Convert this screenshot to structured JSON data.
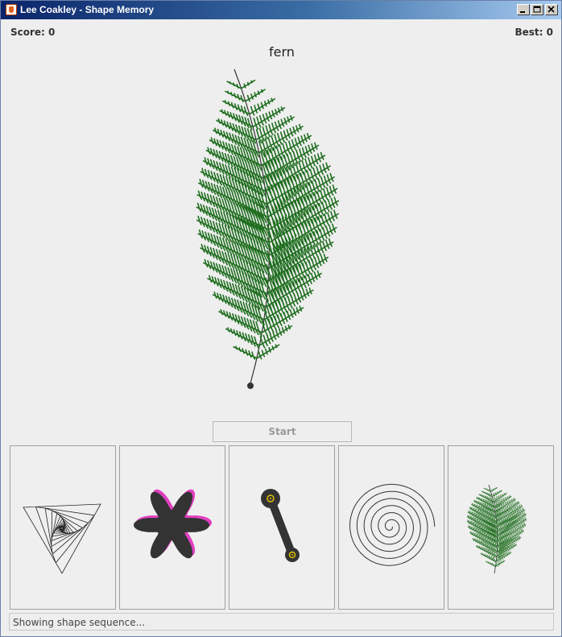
{
  "window": {
    "title": "Lee Coakley - Shape Memory"
  },
  "header": {
    "score_label": "Score: 0",
    "best_label": "Best: 0"
  },
  "display": {
    "shape_name": "fern",
    "shape_icon": "fern-icon"
  },
  "controls": {
    "start_label": "Start"
  },
  "sequence": [
    {
      "name": "triangle-spiral-icon"
    },
    {
      "name": "blob-star-icon"
    },
    {
      "name": "lever-icon"
    },
    {
      "name": "spiral-icon"
    },
    {
      "name": "fern-icon"
    }
  ],
  "status": {
    "text": "Showing shape sequence..."
  },
  "colors": {
    "fern": "#1f6e1f",
    "blob": "#333333",
    "blob_shadow": "#e040c0",
    "ring": "#e0c000"
  }
}
